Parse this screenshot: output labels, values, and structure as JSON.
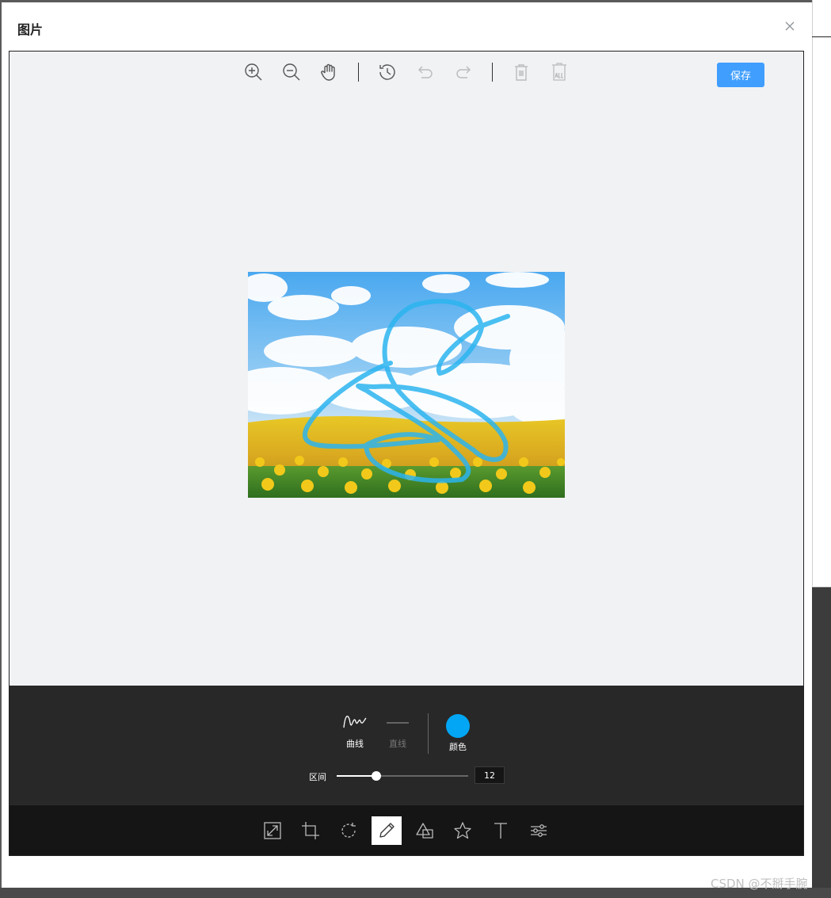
{
  "dialog": {
    "title": "图片",
    "close_icon": "close-icon"
  },
  "top_toolbar": {
    "icons": [
      "zoom-in-icon",
      "zoom-out-icon",
      "hand-icon",
      "history-icon",
      "undo-icon",
      "redo-icon",
      "delete-icon",
      "delete-all-icon"
    ],
    "save_label": "保存"
  },
  "draw_panel": {
    "curve_label": "曲线",
    "line_label": "直线",
    "color_label": "颜色",
    "color": "#02a6f4",
    "range_label": "区间",
    "range_value": "12",
    "range_fraction": 0.3
  },
  "main_menu": {
    "icons": [
      "resize-icon",
      "crop-icon",
      "rotate-icon",
      "draw-icon",
      "shape-icon",
      "star-icon",
      "text-icon",
      "filter-icon"
    ],
    "active": "draw-icon"
  },
  "watermark": "CSDN @不掰手腕"
}
